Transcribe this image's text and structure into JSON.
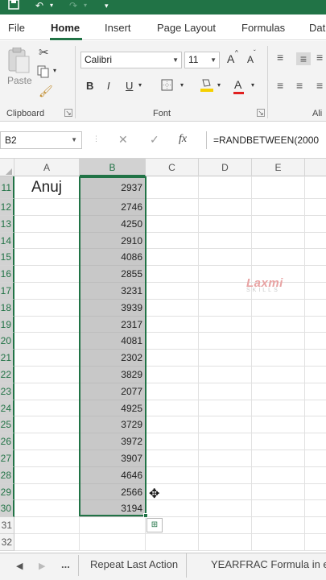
{
  "title_bar": {
    "save_icon": "save-icon",
    "undo_icon": "undo-icon",
    "redo_icon": "redo-icon"
  },
  "menu": {
    "tabs": [
      "File",
      "Home",
      "Insert",
      "Page Layout",
      "Formulas",
      "Dat"
    ],
    "active": "Home"
  },
  "ribbon": {
    "clipboard": {
      "paste_label": "Paste",
      "group_label": "Clipboard"
    },
    "font": {
      "name": "Calibri",
      "size": "11",
      "bold": "B",
      "italic": "I",
      "underline": "U",
      "grow": "A",
      "shrink": "A",
      "color_a": "A",
      "group_label": "Font"
    },
    "alignment": {
      "group_label": "Ali"
    }
  },
  "formula_bar": {
    "name_box": "B2",
    "cancel_icon": "✕",
    "enter_icon": "✓",
    "fx": "fx",
    "formula": "=RANDBETWEEN(2000"
  },
  "columns": [
    "A",
    "B",
    "C",
    "D",
    "E"
  ],
  "rows": [
    {
      "n": "11",
      "a": "Anuj",
      "b": "2937"
    },
    {
      "n": "12",
      "a": "",
      "b": "2746"
    },
    {
      "n": "13",
      "a": "",
      "b": "4250"
    },
    {
      "n": "14",
      "a": "",
      "b": "2910"
    },
    {
      "n": "15",
      "a": "",
      "b": "4086"
    },
    {
      "n": "16",
      "a": "",
      "b": "2855"
    },
    {
      "n": "17",
      "a": "",
      "b": "3231"
    },
    {
      "n": "18",
      "a": "",
      "b": "3939"
    },
    {
      "n": "19",
      "a": "",
      "b": "2317"
    },
    {
      "n": "20",
      "a": "",
      "b": "4081"
    },
    {
      "n": "21",
      "a": "",
      "b": "2302"
    },
    {
      "n": "22",
      "a": "",
      "b": "3829"
    },
    {
      "n": "23",
      "a": "",
      "b": "2077"
    },
    {
      "n": "24",
      "a": "",
      "b": "4925"
    },
    {
      "n": "25",
      "a": "",
      "b": "3729"
    },
    {
      "n": "26",
      "a": "",
      "b": "3972"
    },
    {
      "n": "27",
      "a": "",
      "b": "3907"
    },
    {
      "n": "28",
      "a": "",
      "b": "4646"
    },
    {
      "n": "29",
      "a": "",
      "b": "2566"
    },
    {
      "n": "30",
      "a": "",
      "b": "3194"
    },
    {
      "n": "31",
      "a": "",
      "b": ""
    },
    {
      "n": "32",
      "a": "",
      "b": ""
    }
  ],
  "selected_column": "B",
  "watermark": {
    "line1": "Laxmi",
    "line2": "SKILLS"
  },
  "sheets": {
    "more": "...",
    "tabs": [
      "Repeat Last Action",
      "YEARFRAC Formula in e"
    ]
  },
  "colors": {
    "accent": "#217346",
    "selection": "#c8c8c8"
  }
}
